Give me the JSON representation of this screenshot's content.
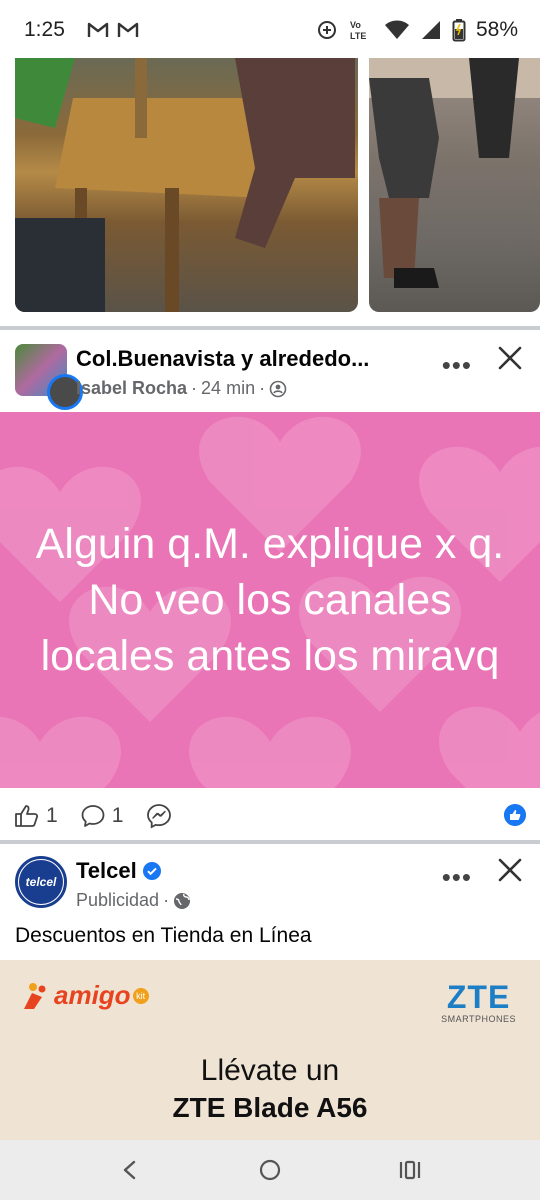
{
  "status_bar": {
    "time": "1:25",
    "battery": "58%",
    "icons": [
      "gmail-icon",
      "gmail-icon",
      "data-saver-icon",
      "volte-icon",
      "wifi-icon",
      "signal-icon",
      "battery-icon"
    ]
  },
  "group_post": {
    "group_name": "Col.Buenavista y alrededo...",
    "author": "Isabel Rocha",
    "time": "24 min",
    "message": "Alguin q.M. explique x q. No veo los canales locales antes los miravq",
    "background_color": "#e974b6",
    "likes": "1",
    "comments": "1"
  },
  "ad_post": {
    "advertiser": "Telcel",
    "logo_text": "telcel",
    "label": "Publicidad",
    "body": "Descuentos en Tienda en Línea",
    "banner": {
      "amigo_logo": "amigo",
      "amigo_kit": "kit",
      "zte_brand": "ZTE",
      "zte_sub": "SMARTPHONES",
      "line1": "Llévate un",
      "line2": "ZTE Blade A56"
    }
  },
  "colors": {
    "facebook_blue": "#1877f2",
    "telcel_blue": "#1a3e8f",
    "amigo_orange": "#e8431f",
    "zte_blue": "#1c7ec4"
  }
}
